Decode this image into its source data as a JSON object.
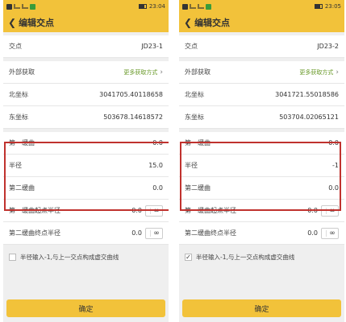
{
  "screens": [
    {
      "status": {
        "time": "23:04"
      },
      "header": {
        "title": "编辑交点"
      },
      "jd": {
        "label": "交点",
        "value": "JD23-1"
      },
      "external": {
        "label": "外部获取",
        "link": "更多获取方式"
      },
      "north": {
        "label": "北坐标",
        "value": "3041705.40118658"
      },
      "east": {
        "label": "东坐标",
        "value": "503678.14618572"
      },
      "curve1": {
        "label": "第一缓曲",
        "value": "0.0"
      },
      "radius": {
        "label": "半径",
        "value": "15.0"
      },
      "curve2": {
        "label": "第二缓曲",
        "value": "0.0"
      },
      "start_radius": {
        "label": "第一缓曲起点半径",
        "value": "0.0",
        "inf": "∞"
      },
      "end_radius": {
        "label": "第二缓曲终点半径",
        "value": "0.0",
        "inf": "∞"
      },
      "option": {
        "label": "半径输入-1,与上一交点构成虚交曲线",
        "checked": false,
        "mark": ""
      },
      "confirm": "确定"
    },
    {
      "status": {
        "time": "23:05"
      },
      "header": {
        "title": "编辑交点"
      },
      "jd": {
        "label": "交点",
        "value": "JD23-2"
      },
      "external": {
        "label": "外部获取",
        "link": "更多获取方式"
      },
      "north": {
        "label": "北坐标",
        "value": "3041721.55018586"
      },
      "east": {
        "label": "东坐标",
        "value": "503704.02065121"
      },
      "curve1": {
        "label": "第一缓曲",
        "value": "0.0"
      },
      "radius": {
        "label": "半径",
        "value": "-1"
      },
      "curve2": {
        "label": "第二缓曲",
        "value": "0.0"
      },
      "start_radius": {
        "label": "第一缓曲起点半径",
        "value": "0.0",
        "inf": "∞"
      },
      "end_radius": {
        "label": "第二缓曲终点半径",
        "value": "0.0",
        "inf": "∞"
      },
      "option": {
        "label": "半径输入-1,与上一交点构成虚交曲线",
        "checked": true,
        "mark": "✓"
      },
      "confirm": "确定"
    }
  ],
  "colors": {
    "accent": "#f2c23a",
    "highlight": "#c0322e",
    "link": "#6a9a2a"
  }
}
